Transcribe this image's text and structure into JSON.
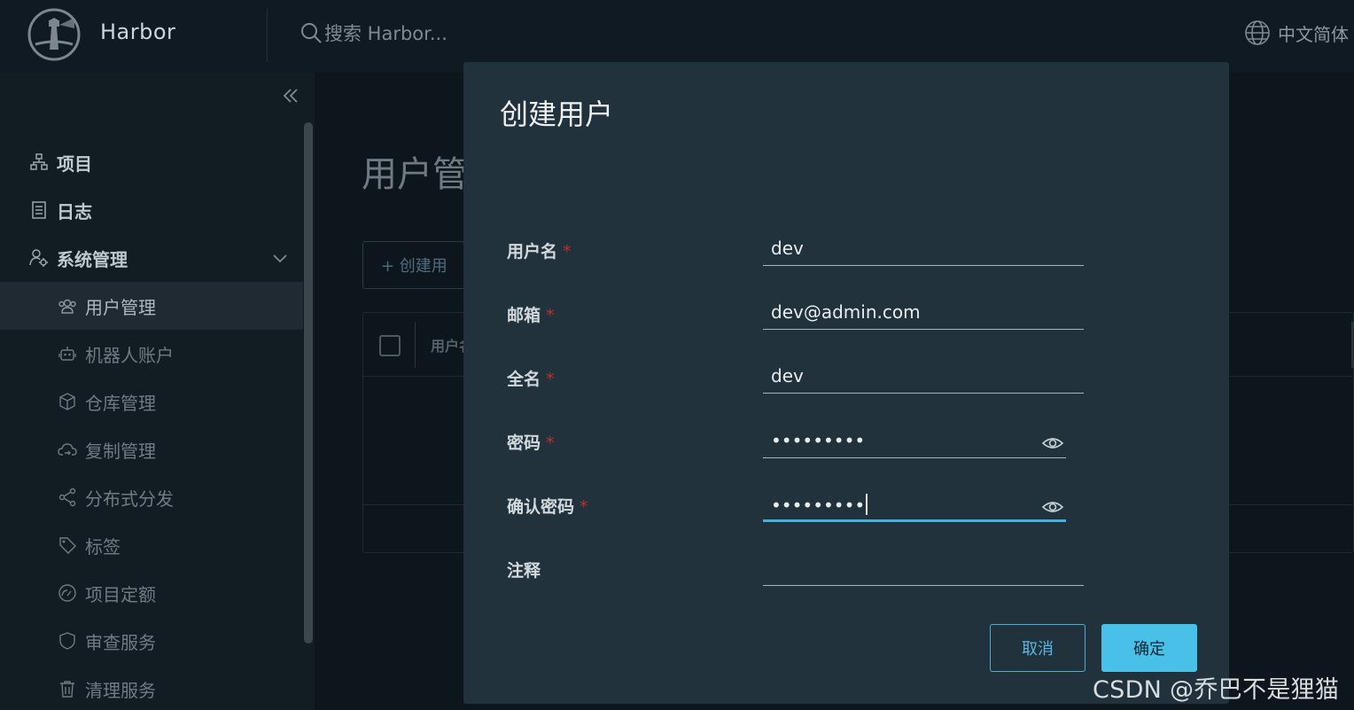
{
  "header": {
    "app_title": "Harbor",
    "search_placeholder": "搜索 Harbor...",
    "language": "中文简体"
  },
  "sidebar": {
    "items": [
      {
        "label": "项目",
        "icon": "project-icon",
        "level": "top"
      },
      {
        "label": "日志",
        "icon": "log-icon",
        "level": "top"
      },
      {
        "label": "系统管理",
        "icon": "system-admin-icon",
        "level": "top",
        "expanded": true
      },
      {
        "label": "用户管理",
        "icon": "users-icon",
        "level": "sub",
        "active": true
      },
      {
        "label": "机器人账户",
        "icon": "robot-icon",
        "level": "sub"
      },
      {
        "label": "仓库管理",
        "icon": "box-icon",
        "level": "sub"
      },
      {
        "label": "复制管理",
        "icon": "cloud-sync-icon",
        "level": "sub"
      },
      {
        "label": "分布式分发",
        "icon": "share-icon",
        "level": "sub"
      },
      {
        "label": "标签",
        "icon": "tag-icon",
        "level": "sub"
      },
      {
        "label": "项目定额",
        "icon": "gauge-icon",
        "level": "sub"
      },
      {
        "label": "审查服务",
        "icon": "shield-icon",
        "level": "sub"
      },
      {
        "label": "清理服务",
        "icon": "trash-icon",
        "level": "sub"
      }
    ]
  },
  "main": {
    "page_title": "用户管",
    "create_button": "+ 创建用",
    "table_col_header": "用户名"
  },
  "modal": {
    "title": "创建用户",
    "fields": [
      {
        "label": "用户名",
        "value": "dev",
        "required": true
      },
      {
        "label": "邮箱",
        "value": "dev@admin.com",
        "required": true
      },
      {
        "label": "全名",
        "value": "dev",
        "required": true
      },
      {
        "label": "密码",
        "value": "•••••••••",
        "required": true
      },
      {
        "label": "确认密码",
        "value": "•••••••••",
        "required": true
      },
      {
        "label": "注释",
        "value": "",
        "required": false
      }
    ],
    "required_mark": "*",
    "cancel_label": "取消",
    "ok_label": "确定"
  },
  "watermark": "CSDN @乔巴不是狸猫",
  "colors": {
    "accent": "#49afd9",
    "primary_button": "#49c0e8",
    "required": "#c02e2a",
    "modal_bg": "#21323c"
  }
}
